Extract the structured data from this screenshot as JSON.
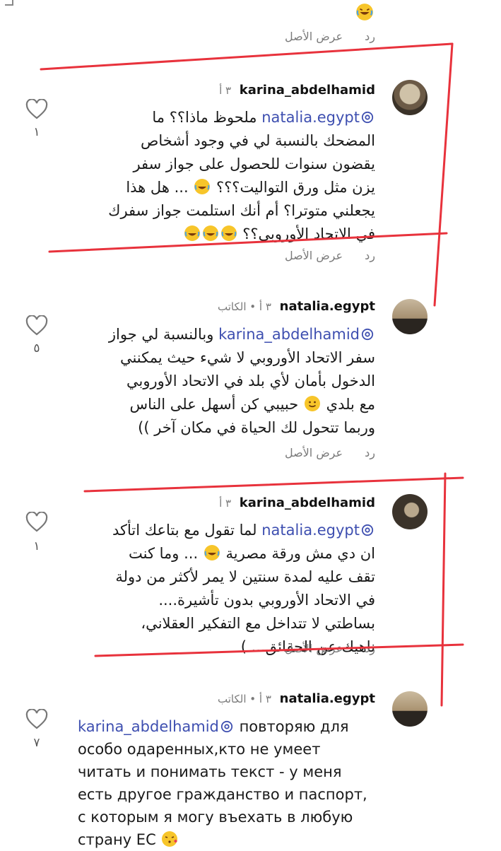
{
  "actions": {
    "reply": "رد",
    "see_original": "عرض الأصل"
  },
  "comments": [
    {
      "username": "karina_abdelhamid",
      "meta": "٣ أ",
      "mention": "natalia.egypt",
      "text": "ملحوظ ماذا؟؟ ما المضحك بالنسبة لي في وجود أشخاص يقضون سنوات للحصول على جواز سفر يزن مثل ورق التواليت؟؟؟",
      "text2": "... هل هذا يجعلني متوترا؟ أم أنك استلمت جواز سفرك في الاتحاد الأوروبي؟؟",
      "likes": "١"
    },
    {
      "username": "natalia.egypt",
      "meta": "٣ أ • الكاتب",
      "mention": "karina_abdelhamid",
      "text": "وبالنسبة لي جواز سفر الاتحاد الأوروبي لا شيء حيث يمكنني الدخول بأمان لأي بلد في الاتحاد الأوروبي مع بلدي",
      "text2": "حبيبي كن أسهل على الناس وربما تتحول لك الحياة في مكان آخر ))",
      "likes": "٥"
    },
    {
      "username": "karina_abdelhamid",
      "meta": "٣ أ",
      "mention": "natalia.egypt",
      "text": "لما تقول مع بتاعك اتأكد ان دي مش ورقة مصرية",
      "text2": "... وما كنت تقف عليه لمدة سنتين لا يمر لأكثر من دولة في الاتحاد الأوروبي بدون تأشيرة.... بساطتي لا تتداخل مع التفكير العقلاني، ناهيك عن الحقائق... )",
      "likes": "١"
    },
    {
      "username": "natalia.egypt",
      "meta": "٣ أ • الكاتب",
      "mention": "karina_abdelhamid",
      "text": "повторяю для особо одаренных,кто не умеет читать и понимать текст - у меня есть другое гражданство и паспорт, с которым я могу въехать в любую страну ЕС",
      "likes": "٧"
    }
  ],
  "colors": {
    "mention": "#3e4fb0",
    "annotation": "#e8323c"
  }
}
